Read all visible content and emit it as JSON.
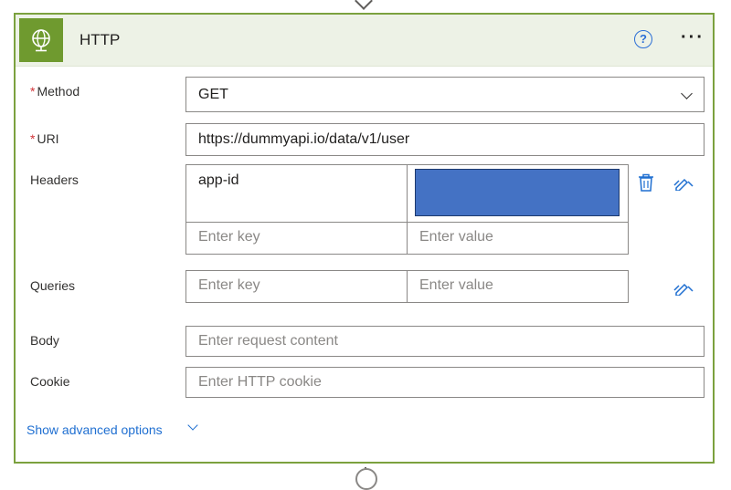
{
  "header": {
    "title": "HTTP",
    "help_icon": "help-circle-icon",
    "more_icon": "more-horizontal-icon",
    "icon": "globe-icon"
  },
  "accent": "#6f9a2f",
  "link_color": "#1f6fd1",
  "required_marker": "*",
  "method": {
    "label": "Method",
    "value": "GET",
    "icon": "chevron-down-icon"
  },
  "uri": {
    "label": "URI",
    "value": "https://dummyapi.io/data/v1/user"
  },
  "headers": {
    "label": "Headers",
    "rows": [
      {
        "key": "app-id",
        "value": ""
      }
    ],
    "key_placeholder": "Enter key",
    "value_placeholder": "Enter value",
    "redacted_color": "#4472c4"
  },
  "queries": {
    "label": "Queries",
    "key_placeholder": "Enter key",
    "value_placeholder": "Enter value"
  },
  "body": {
    "label": "Body",
    "placeholder": "Enter request content"
  },
  "cookie": {
    "label": "Cookie",
    "placeholder": "Enter HTTP cookie"
  },
  "advanced": {
    "label": "Show advanced options"
  }
}
